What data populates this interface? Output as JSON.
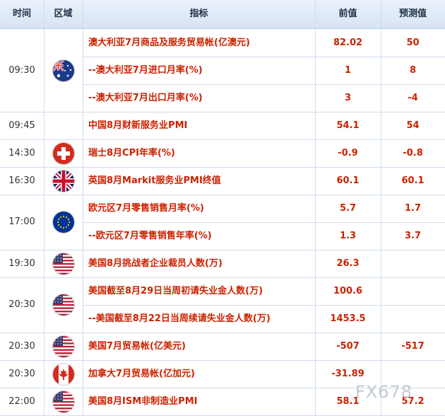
{
  "headers": [
    "时间",
    "区域",
    "指标",
    "前值",
    "预测值"
  ],
  "groups": [
    {
      "time": "09:30",
      "flag": "australia-flag-icon",
      "rows": [
        {
          "indicator": "澳大利亚7月商品及服务贸易帐(亿澳元)",
          "prev": "82.02",
          "forecast": "50"
        },
        {
          "indicator": "--澳大利亚7月进口月率(%)",
          "prev": "1",
          "forecast": "8"
        },
        {
          "indicator": "--澳大利亚7月出口月率(%)",
          "prev": "3",
          "forecast": "-4"
        }
      ]
    },
    {
      "time": "09:45",
      "flag": "",
      "rows": [
        {
          "indicator": "中国8月财新服务业PMI",
          "prev": "54.1",
          "forecast": "54"
        }
      ]
    },
    {
      "time": "14:30",
      "flag": "switzerland-flag-icon",
      "rows": [
        {
          "indicator": "瑞士8月CPI年率(%)",
          "prev": "-0.9",
          "forecast": "-0.8"
        }
      ]
    },
    {
      "time": "16:30",
      "flag": "uk-flag-icon",
      "rows": [
        {
          "indicator": "英国8月Markit服务业PMI终值",
          "prev": "60.1",
          "forecast": "60.1"
        }
      ]
    },
    {
      "time": "17:00",
      "flag": "eu-flag-icon",
      "rows": [
        {
          "indicator": "欧元区7月零售销售月率(%)",
          "prev": "5.7",
          "forecast": "1.7"
        },
        {
          "indicator": "--欧元区7月零售销售年率(%)",
          "prev": "1.3",
          "forecast": "3.7"
        }
      ]
    },
    {
      "time": "19:30",
      "flag": "us-flag-icon",
      "rows": [
        {
          "indicator": "美国8月挑战者企业裁员人数(万)",
          "prev": "26.3",
          "forecast": ""
        }
      ]
    },
    {
      "time": "20:30",
      "flag": "us-flag-icon",
      "rows": [
        {
          "indicator": "美国截至8月29日当周初请失业金人数(万)",
          "prev": "100.6",
          "forecast": ""
        },
        {
          "indicator": "--美国截至8月22日当周续请失业金人数(万)",
          "prev": "1453.5",
          "forecast": ""
        }
      ]
    },
    {
      "time": "20:30",
      "flag": "us-flag-icon",
      "rows": [
        {
          "indicator": "美国7月贸易帐(亿美元)",
          "prev": "-507",
          "forecast": "-517"
        }
      ]
    },
    {
      "time": "20:30",
      "flag": "canada-flag-icon",
      "rows": [
        {
          "indicator": "加拿大7月贸易帐(亿加元)",
          "prev": "-31.89",
          "forecast": ""
        }
      ]
    },
    {
      "time": "22:00",
      "flag": "us-flag-icon",
      "rows": [
        {
          "indicator": "美国8月ISM非制造业PMI",
          "prev": "58.1",
          "forecast": "57.2"
        }
      ]
    }
  ],
  "watermark": "FX678"
}
